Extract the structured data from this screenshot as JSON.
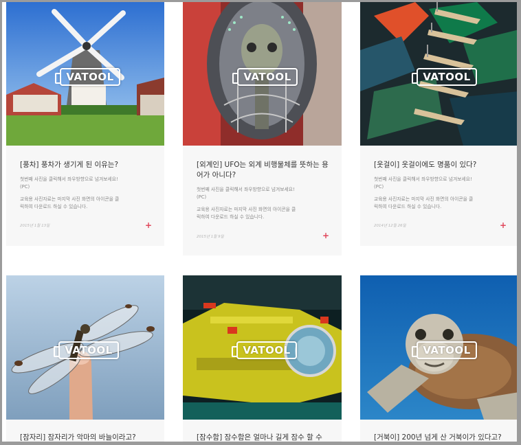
{
  "logo_text": "VATOOL",
  "cards": [
    {
      "title": "[풍차] 풍차가 생기게 된 이유는?",
      "line1": "첫번째 사진을 클릭해서 좌우방향으로 넘겨보세요!",
      "line2": "(PC)",
      "line3": "교육용 사진자료는 마지막 사진 화면의 아이콘을 클",
      "line4": "릭하여 다운로드 하실 수 있습니다.",
      "date": "2015년 1월 13일",
      "plus": "+"
    },
    {
      "title_line1": "[외계인] UFO는 외계 비행물체를 뜻하는 용",
      "title_line2": "어가 아니다?",
      "line1": "첫번째 사진을 클릭해서 좌우방향으로 넘겨보세요!",
      "line2": "(PC)",
      "line3": "교육용 사진자료는 마지막 사진 화면의 아이콘을 클",
      "line4": "릭하여 다운로드 하실 수 있습니다.",
      "date": "2015년 1월 9일",
      "plus": "+"
    },
    {
      "title": "[옷걸이] 옷걸이에도 명품이 있다?",
      "line1": "첫번째 사진을 클릭해서 좌우방향으로 넘겨보세요!",
      "line2": "(PC)",
      "line3": "교육용 사진자료는 마지막 사진 화면의 아이콘을 클",
      "line4": "릭하여 다운로드 하실 수 있습니다.",
      "date": "2014년 12월 26일",
      "plus": "+"
    },
    {
      "title": "[잠자리] 잠자리가 악마의 바늘이라고?"
    },
    {
      "title": "[잠수함] 잠수함은 얼마나 길게 잠수 할 수"
    },
    {
      "title": "[거북이] 200년 넘게 산 거북이가 있다고?"
    }
  ]
}
